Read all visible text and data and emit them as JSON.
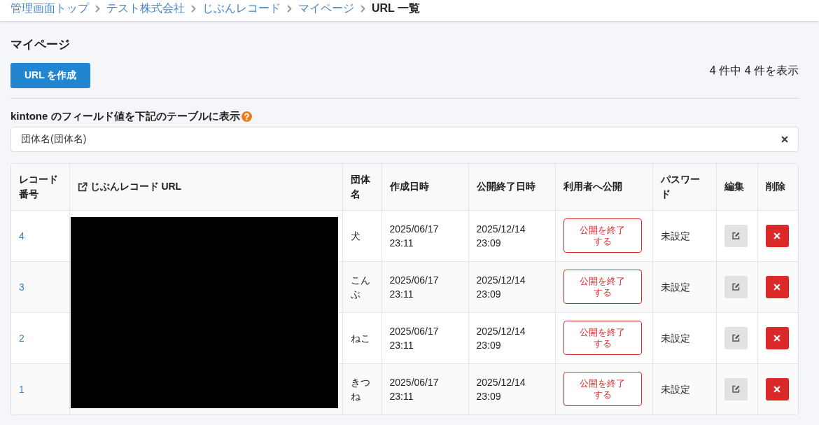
{
  "breadcrumb": [
    {
      "label": "管理画面トップ",
      "current": false
    },
    {
      "label": "テスト株式会社",
      "current": false
    },
    {
      "label": "じぶんレコード",
      "current": false
    },
    {
      "label": "マイページ",
      "current": false
    },
    {
      "label": "URL 一覧",
      "current": true
    }
  ],
  "page_title": "マイページ",
  "create_button": "URL を作成",
  "result_count": "4 件中 4 件を表示",
  "field_selector": {
    "label": "kintone のフィールド値を下記のテーブルに表示",
    "value": "団体名(団体名)"
  },
  "table": {
    "columns": [
      "レコード番号",
      "じぶんレコード URL",
      "団体名",
      "作成日時",
      "公開終了日時",
      "利用者へ公開",
      "パスワード",
      "編集",
      "削除"
    ],
    "rows": [
      {
        "record_number": "4",
        "group_name": "犬",
        "created_at": "2025/06/17 23:11",
        "publish_end": "2025/12/14 23:09",
        "publish_button": "公開を終了する",
        "password": "未設定"
      },
      {
        "record_number": "3",
        "group_name": "こんぶ",
        "created_at": "2025/06/17 23:11",
        "publish_end": "2025/12/14 23:09",
        "publish_button": "公開を終了する",
        "password": "未設定"
      },
      {
        "record_number": "2",
        "group_name": "ねこ",
        "created_at": "2025/06/17 23:11",
        "publish_end": "2025/12/14 23:09",
        "publish_button": "公開を終了する",
        "password": "未設定"
      },
      {
        "record_number": "1",
        "group_name": "きつね",
        "created_at": "2025/06/17 23:11",
        "publish_end": "2025/12/14 23:09",
        "publish_button": "公開を終了する",
        "password": "未設定"
      }
    ]
  }
}
